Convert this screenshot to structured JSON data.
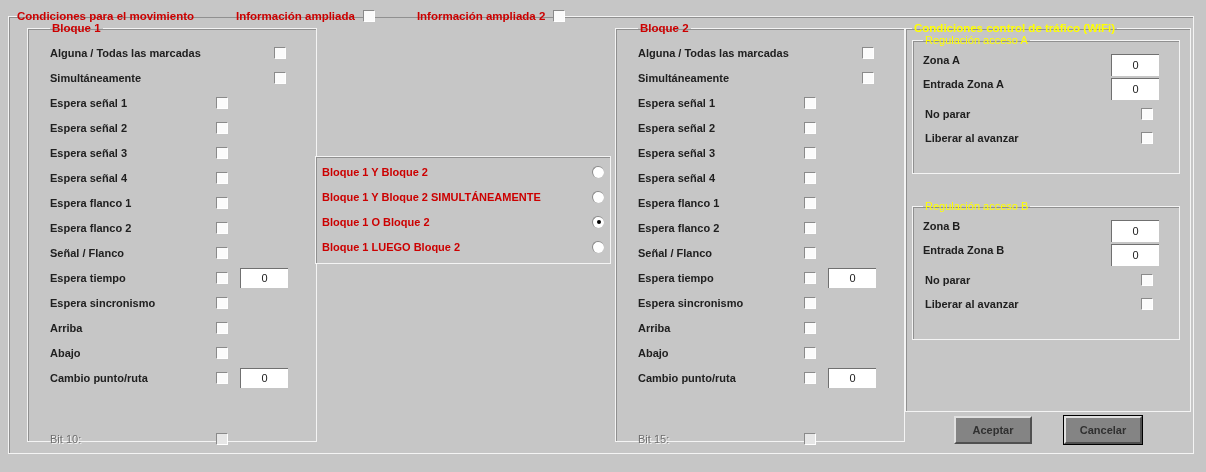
{
  "header": {
    "title": "Condiciones para el movimiento",
    "options": [
      {
        "label": "Información ampliada",
        "checked": false
      },
      {
        "label": "Información ampliada 2",
        "checked": false
      }
    ]
  },
  "blocks": [
    {
      "title": "Bloque 1",
      "rows": [
        {
          "label": "Alguna / Todas las marcadas",
          "kind": "wide",
          "checked": false
        },
        {
          "label": "Simultáneamente",
          "kind": "wide",
          "checked": false
        },
        {
          "label": "Espera señal 1",
          "kind": "normal",
          "checked": false
        },
        {
          "label": "Espera señal 2",
          "kind": "normal",
          "checked": false
        },
        {
          "label": "Espera señal 3",
          "kind": "normal",
          "checked": false
        },
        {
          "label": "Espera señal 4",
          "kind": "normal",
          "checked": false
        },
        {
          "label": "Espera flanco 1",
          "kind": "normal",
          "checked": false
        },
        {
          "label": "Espera flanco 2",
          "kind": "normal",
          "checked": false
        },
        {
          "label": "Señal / Flanco",
          "kind": "normal",
          "checked": false
        },
        {
          "label": "Espera tiempo",
          "kind": "value",
          "checked": false,
          "value": "0"
        },
        {
          "label": "Espera sincronismo",
          "kind": "normal",
          "checked": false
        },
        {
          "label": "Arriba",
          "kind": "normal",
          "checked": false
        },
        {
          "label": "Abajo",
          "kind": "normal",
          "checked": false
        },
        {
          "label": "Cambio punto/ruta",
          "kind": "value",
          "checked": false,
          "value": "0"
        },
        {
          "label": "Bit 10:",
          "kind": "bit",
          "checked": false,
          "disabled": true
        }
      ]
    },
    {
      "title": "Bloque 2",
      "rows": [
        {
          "label": "Alguna / Todas las marcadas",
          "kind": "wide",
          "checked": false
        },
        {
          "label": "Simultáneamente",
          "kind": "wide",
          "checked": false
        },
        {
          "label": "Espera señal 1",
          "kind": "normal",
          "checked": false
        },
        {
          "label": "Espera señal 2",
          "kind": "normal",
          "checked": false
        },
        {
          "label": "Espera señal 3",
          "kind": "normal",
          "checked": false
        },
        {
          "label": "Espera señal 4",
          "kind": "normal",
          "checked": false
        },
        {
          "label": "Espera flanco 1",
          "kind": "normal",
          "checked": false
        },
        {
          "label": "Espera flanco 2",
          "kind": "normal",
          "checked": false
        },
        {
          "label": "Señal / Flanco",
          "kind": "normal",
          "checked": false
        },
        {
          "label": "Espera tiempo",
          "kind": "value",
          "checked": false,
          "value": "0"
        },
        {
          "label": "Espera sincronismo",
          "kind": "normal",
          "checked": false
        },
        {
          "label": "Arriba",
          "kind": "normal",
          "checked": false
        },
        {
          "label": "Abajo",
          "kind": "normal",
          "checked": false
        },
        {
          "label": "Cambio punto/ruta",
          "kind": "value",
          "checked": false,
          "value": "0"
        },
        {
          "label": "Bit 15:",
          "kind": "bit",
          "checked": false,
          "disabled": true
        }
      ]
    }
  ],
  "combine": [
    {
      "label": "Bloque 1 Y Bloque 2",
      "selected": false
    },
    {
      "label": "Bloque 1 Y Bloque 2 SIMULTÁNEAMENTE",
      "selected": false
    },
    {
      "label": "Bloque 1 O Bloque 2",
      "selected": true
    },
    {
      "label": "Bloque 1 LUEGO Bloque 2",
      "selected": false
    }
  ],
  "traffic": {
    "title": "Condiciones control de tráfico (WiFi)",
    "groups": [
      {
        "title": "Regulación acceso A",
        "fields": [
          {
            "label": "Zona A",
            "value": "0"
          },
          {
            "label": "Entrada Zona A",
            "value": "0"
          }
        ],
        "checks": [
          {
            "label": "No parar",
            "checked": false
          },
          {
            "label": "Liberar al avanzar",
            "checked": false
          }
        ]
      },
      {
        "title": "Regulación acceso B",
        "fields": [
          {
            "label": "Zona B",
            "value": "0"
          },
          {
            "label": "Entrada Zona B",
            "value": "0"
          }
        ],
        "checks": [
          {
            "label": "No parar",
            "checked": false
          },
          {
            "label": "Liberar al avanzar",
            "checked": false
          }
        ]
      }
    ]
  },
  "buttons": [
    {
      "label": "Aceptar"
    },
    {
      "label": "Cancelar"
    }
  ]
}
